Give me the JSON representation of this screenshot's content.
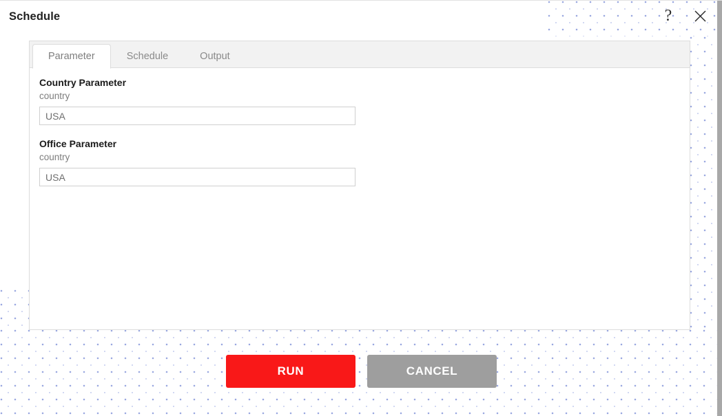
{
  "window": {
    "title": "Schedule"
  },
  "title_actions": [
    {
      "name": "help-icon",
      "glyph": "?"
    },
    {
      "name": "close-icon",
      "glyph": "✕"
    }
  ],
  "tabs": [
    {
      "label": "Parameter",
      "active": true
    },
    {
      "label": "Schedule",
      "active": false
    },
    {
      "label": "Output",
      "active": false
    }
  ],
  "parameters": [
    {
      "label": "Country Parameter",
      "sublabel": "country",
      "value": "USA",
      "placeholder": "USA"
    },
    {
      "label": "Office Parameter",
      "sublabel": "country",
      "value": "USA",
      "placeholder": "USA"
    }
  ],
  "footer": {
    "run_label": "RUN",
    "cancel_label": "CANCEL"
  },
  "colors": {
    "run_background": "#f91818",
    "cancel_background": "#9e9e9e",
    "panel_border": "#dcdcdc",
    "tab_strip_background": "#f2f2f2",
    "pattern_dot": "#9aa8e0"
  }
}
